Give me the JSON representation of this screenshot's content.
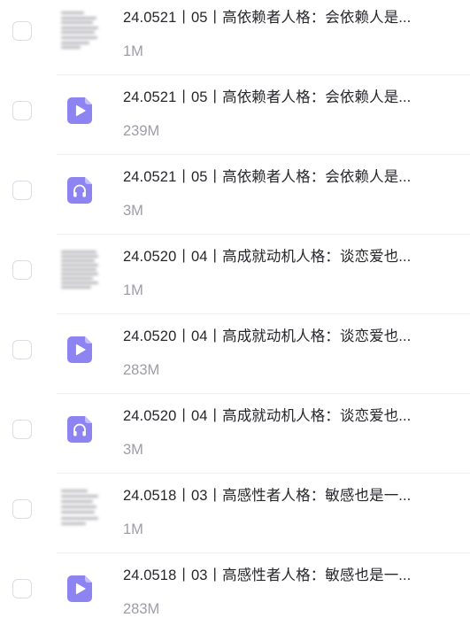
{
  "files": [
    {
      "name": "24.0521丨05丨高依赖者人格：会依赖人是...",
      "size": "1M",
      "type": "document",
      "icon": "document-thumbnail-icon"
    },
    {
      "name": "24.0521丨05丨高依赖者人格：会依赖人是...",
      "size": "239M",
      "type": "video",
      "icon": "video-file-icon"
    },
    {
      "name": "24.0521丨05丨高依赖者人格：会依赖人是...",
      "size": "3M",
      "type": "audio",
      "icon": "audio-file-icon"
    },
    {
      "name": "24.0520丨04丨高成就动机人格：谈恋爱也...",
      "size": "1M",
      "type": "document",
      "icon": "document-thumbnail-icon"
    },
    {
      "name": "24.0520丨04丨高成就动机人格：谈恋爱也...",
      "size": "283M",
      "type": "video",
      "icon": "video-file-icon"
    },
    {
      "name": "24.0520丨04丨高成就动机人格：谈恋爱也...",
      "size": "3M",
      "type": "audio",
      "icon": "audio-file-icon"
    },
    {
      "name": "24.0518丨03丨高感性者人格：敏感也是一...",
      "size": "1M",
      "type": "document",
      "icon": "document-thumbnail-icon"
    },
    {
      "name": "24.0518丨03丨高感性者人格：敏感也是一...",
      "size": "283M",
      "type": "video",
      "icon": "video-file-icon"
    }
  ],
  "colors": {
    "icon_bg": "#8d84f2",
    "icon_fold": "#c3beff",
    "name_text": "#26262b",
    "size_text": "#9d9da6",
    "checkbox_border": "#dcdce2"
  }
}
